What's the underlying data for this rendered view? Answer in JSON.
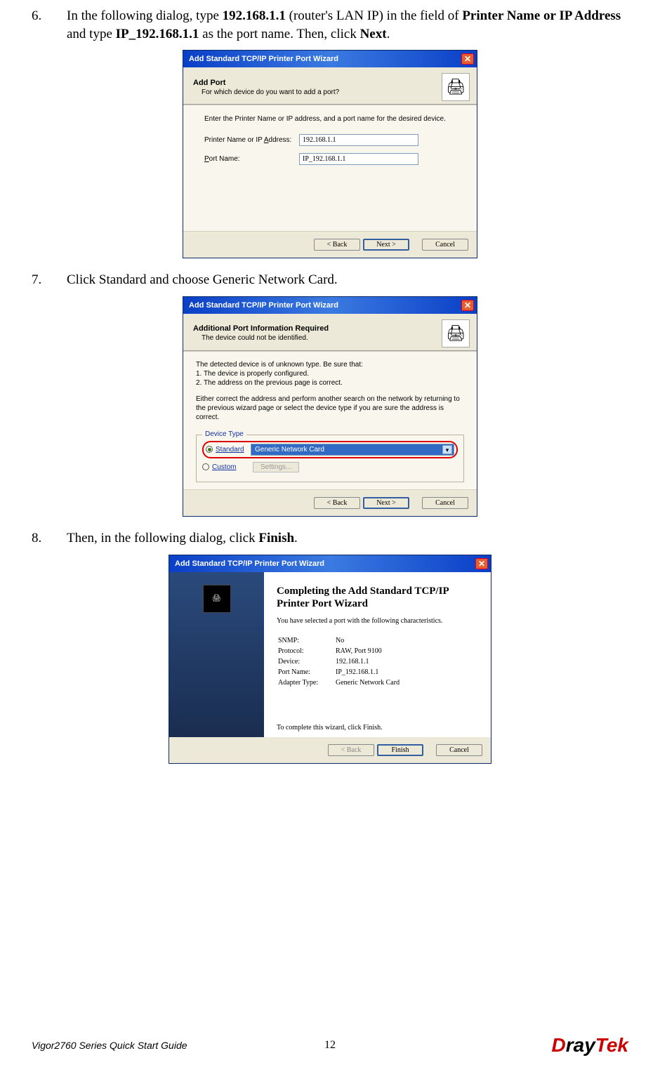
{
  "step6": {
    "num": "6.",
    "text_0": "In the following dialog, type ",
    "bold_0": "192.168.1.1",
    "text_1": " (router's LAN IP) in the field of ",
    "bold_1": "Printer Name or IP Address",
    "text_2": " and type ",
    "bold_2": "IP_192.168.1.1",
    "text_3": " as the port name. Then, click ",
    "bold_3": "Next",
    "text_4": "."
  },
  "dialog1": {
    "title": "Add Standard TCP/IP Printer Port Wizard",
    "header_title": "Add Port",
    "header_sub": "For which device do you want to add a port?",
    "instr": "Enter the Printer Name or IP address, and a port name for the desired device.",
    "field1_label": "Printer Name or IP Address:",
    "field1_value": "192.168.1.1",
    "field2_label": "Port Name:",
    "field2_value": "IP_192.168.1.1",
    "back": "< Back",
    "next": "Next >",
    "cancel": "Cancel"
  },
  "step7": {
    "num": "7.",
    "text": "Click Standard and choose Generic Network Card."
  },
  "dialog2": {
    "title": "Add Standard TCP/IP Printer Port Wizard",
    "header_title": "Additional Port Information Required",
    "header_sub": "The device could not be identified.",
    "body_line1": "The detected device is of unknown type.  Be sure that:",
    "body_line2": "1.  The device is properly configured.",
    "body_line3": "2.  The address on the previous page is correct.",
    "body_para2": "Either correct the address and perform another search on the network by returning to the previous wizard page or select the device type if you are sure the address is correct.",
    "legend": "Device Type",
    "radio1": "Standard",
    "dropdown": "Generic Network Card",
    "radio2": "Custom",
    "settings": "Settings...",
    "back": "< Back",
    "next": "Next >",
    "cancel": "Cancel"
  },
  "step8": {
    "num": "8.",
    "text_0": "Then, in the following dialog, click ",
    "bold_0": "Finish",
    "text_1": "."
  },
  "dialog3": {
    "title": "Add Standard TCP/IP Printer Port Wizard",
    "finish_title": "Completing the Add Standard TCP/IP Printer Port Wizard",
    "finish_desc": "You have selected a port with the following characteristics.",
    "rows": {
      "r0k": "SNMP:",
      "r0v": "No",
      "r1k": "Protocol:",
      "r1v": "RAW, Port 9100",
      "r2k": "Device:",
      "r2v": "192.168.1.1",
      "r3k": "Port Name:",
      "r3v": "IP_192.168.1.1",
      "r4k": "Adapter Type:",
      "r4v": "Generic Network Card"
    },
    "complete": "To complete this wizard, click Finish.",
    "back": "< Back",
    "finish": "Finish",
    "cancel": "Cancel"
  },
  "footer": {
    "left": "Vigor2760 Series Quick Start Guide",
    "page": "12"
  }
}
